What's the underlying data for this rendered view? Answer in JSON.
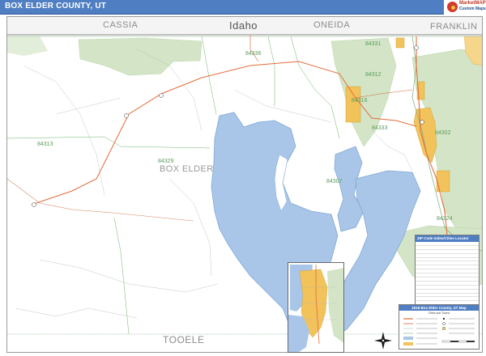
{
  "header": {
    "title": "BOX ELDER COUNTY, UT"
  },
  "logo": {
    "name": "Market Maps",
    "tagline": "Specialists in Custom Maps"
  },
  "map": {
    "neighbor_regions": {
      "cassia": "CASSIA",
      "idaho": "Idaho",
      "oneida": "ONEIDA",
      "franklin": "FRANKLIN",
      "tooele": "TOOELE"
    },
    "county_name": "BOX ELDER",
    "zip_labels": {
      "z84336": "84336",
      "z84331": "84331",
      "z84312": "84312",
      "z84313": "84313",
      "z84329": "84329",
      "z84307": "84307",
      "z84333": "84333",
      "z84316": "84316",
      "z84302": "84302",
      "z84324": "84324"
    },
    "colors": {
      "water": "#a9c6e8",
      "water_edge": "#7fa7d6",
      "forest": "#d3e5c6",
      "urban": "#f2c25b",
      "interstate": "#e46b3b",
      "highway": "#d2663b",
      "county_border": "#8ab58a",
      "title_bar": "#4f7ec2"
    }
  },
  "legends": {
    "zip_table_title": "ZIP Code Index/Cities Locator"
  },
  "key": {
    "title": "2018 Box Elder County, UT Map",
    "subtitle": "Cities and Towns"
  }
}
